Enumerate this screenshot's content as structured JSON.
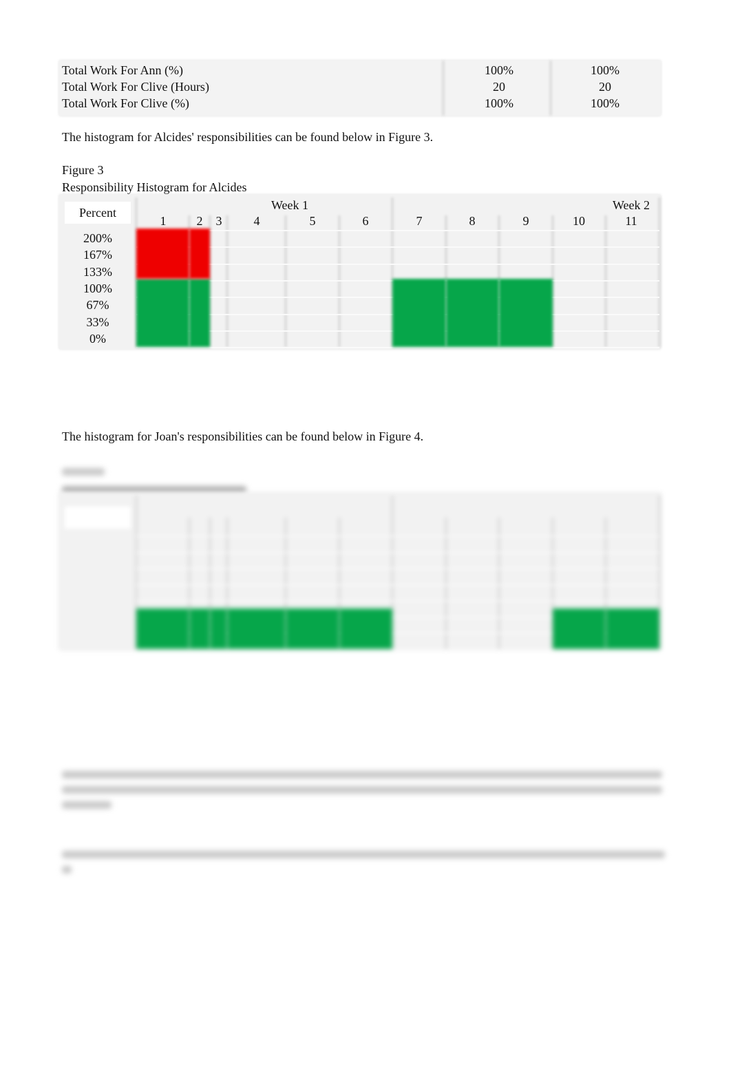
{
  "summary_table": {
    "rows": [
      {
        "label": "Total Work For Ann (%)",
        "week1": "100%",
        "week2": "100%"
      },
      {
        "label": "Total Work For Clive (Hours)",
        "week1": "20",
        "week2": "20"
      },
      {
        "label": "Total Work For Clive (%)",
        "week1": "100%",
        "week2": "100%"
      }
    ]
  },
  "intro_alcides": "The histogram for Alcides' responsibilities can be found below in Figure 3.",
  "figure3": {
    "label": "Figure 3",
    "title": "Responsibility Histogram for Alcides"
  },
  "intro_joan": "The histogram for Joan's responsibilities can be found below in Figure 4.",
  "colors": {
    "over_allocated": "#ee0000",
    "allocated": "#06a64a",
    "grid_bg": "#f2f2f2"
  },
  "chart_data": [
    {
      "type": "heatmap",
      "title": "Responsibility Histogram for Alcides",
      "row_header": "Percent",
      "y_ticks": [
        "200%",
        "167%",
        "133%",
        "100%",
        "67%",
        "33%",
        "0%"
      ],
      "week_labels": [
        "Week 1",
        "Week 2"
      ],
      "columns": [
        "1",
        "2",
        "3",
        "4",
        "5",
        "6",
        "7",
        "8",
        "9",
        "10",
        "11"
      ],
      "allocation_percent": [
        200,
        200,
        0,
        0,
        0,
        0,
        100,
        100,
        100,
        0,
        0
      ]
    },
    {
      "type": "heatmap",
      "blurred": true,
      "allocation_percent": [
        100,
        100,
        100,
        100,
        100,
        100,
        0,
        0,
        0,
        100,
        100
      ]
    }
  ]
}
